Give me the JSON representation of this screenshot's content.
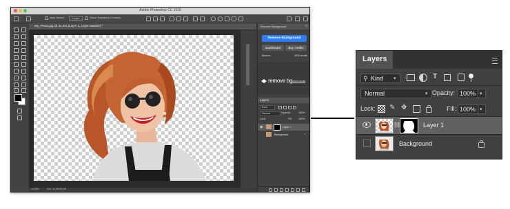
{
  "photoshop": {
    "app_title": "Adobe Photoshop CC 2019",
    "options_bar": {
      "auto_select_label": "Auto-Select:",
      "auto_select_value": "Layer",
      "transform_label": "Show Transform Controls"
    },
    "document_tab": "My_Photo.jpg @ 34,5% (Layer 1, Layer Mask/8) *",
    "status_zoom": "44,28%",
    "status_doc": "Doc: 11,3M/18,1M",
    "remove_bg_panel": {
      "title": "Remove Background",
      "remove_button": "Remove Background",
      "dashboard_button": "Dashboard",
      "buy_button": "Buy credits",
      "balance_label": "Balance",
      "credits": "4876 credits",
      "logo_text": "remove bg",
      "link_text": "how it works"
    },
    "small_layers_panel": {
      "title": "Layers",
      "kind": "Kind",
      "blend": "Normal",
      "opacity_label": "Opacity:",
      "opacity": "100%",
      "lock_label": "Lock:",
      "fill_label": "Fill:",
      "fill": "100%",
      "layers": [
        "Layer 1",
        "Background"
      ]
    }
  },
  "layers_panel": {
    "tab_label": "Layers",
    "filter_kind": "Kind",
    "blend_mode": "Normal",
    "opacity_label": "Opacity:",
    "opacity_value": "100%",
    "lock_label": "Lock:",
    "fill_label": "Fill:",
    "fill_value": "100%",
    "layers": [
      {
        "name": "Layer 1",
        "visible": true,
        "selected": true,
        "has_mask": true
      },
      {
        "name": "Background",
        "visible": false,
        "selected": false,
        "locked": true
      }
    ]
  },
  "colors": {
    "accent_blue": "#2f7ef5",
    "panel_bg": "#404040",
    "selected_row": "#616161"
  }
}
